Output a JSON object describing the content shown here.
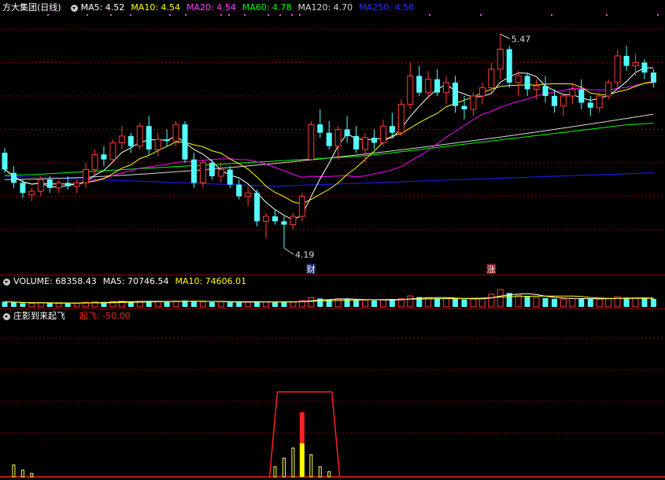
{
  "colors": {
    "background": "#000000",
    "up": "#ff3b3b",
    "down": "#54ffff",
    "ma5": "#ffffff",
    "ma10": "#ffff00",
    "ma20": "#ff00ff",
    "ma60": "#00ff00",
    "ma120": "#d8d8d8",
    "ma250": "#2020ff",
    "grid": "#8a0000"
  },
  "price_panel": {
    "title": "方大集团(日线)",
    "ma_labels": [
      {
        "text": "MA5: 4.52",
        "color": "#ffffff"
      },
      {
        "text": "MA10: 4.54",
        "color": "#ffff00"
      },
      {
        "text": "MA20: 4.54",
        "color": "#ff44ff"
      },
      {
        "text": "MA60: 4.78",
        "color": "#00ff00"
      },
      {
        "text": "MA120: 4.70",
        "color": "#d8d8d8"
      },
      {
        "text": "MA250: 4.56",
        "color": "#3030ff"
      }
    ],
    "high_label": "5.47",
    "low_label": "4.19",
    "markers": [
      {
        "text": "财",
        "index": 34
      },
      {
        "text": "涨",
        "index": 54
      }
    ]
  },
  "volume_panel": {
    "labels": [
      {
        "text": "VOLUME: 68358.43",
        "color": "#ffffff"
      },
      {
        "text": "MA5: 70746.54",
        "color": "#ffffff"
      },
      {
        "text": "MA10: 74606.01",
        "color": "#ffff00"
      }
    ]
  },
  "indicator_panel": {
    "title": "庄影到来起飞",
    "value_label": "起飞: -50.00"
  },
  "chart_data": {
    "type": "candlestick",
    "price_range": [
      4.05,
      5.58
    ],
    "ohlc": [
      [
        4.76,
        4.79,
        4.64,
        4.66
      ],
      [
        4.64,
        4.68,
        4.55,
        4.58
      ],
      [
        4.58,
        4.6,
        4.49,
        4.52
      ],
      [
        4.51,
        4.55,
        4.47,
        4.53
      ],
      [
        4.53,
        4.62,
        4.5,
        4.6
      ],
      [
        4.6,
        4.62,
        4.52,
        4.55
      ],
      [
        4.55,
        4.6,
        4.52,
        4.58
      ],
      [
        4.58,
        4.62,
        4.54,
        4.56
      ],
      [
        4.56,
        4.6,
        4.52,
        4.58
      ],
      [
        4.58,
        4.7,
        4.55,
        4.66
      ],
      [
        4.66,
        4.78,
        4.63,
        4.75
      ],
      [
        4.75,
        4.8,
        4.68,
        4.72
      ],
      [
        4.72,
        4.84,
        4.7,
        4.82
      ],
      [
        4.82,
        4.92,
        4.78,
        4.86
      ],
      [
        4.86,
        4.88,
        4.76,
        4.8
      ],
      [
        4.8,
        4.94,
        4.78,
        4.92
      ],
      [
        4.92,
        4.98,
        4.75,
        4.78
      ],
      [
        4.78,
        4.88,
        4.74,
        4.84
      ],
      [
        4.84,
        4.9,
        4.8,
        4.83
      ],
      [
        4.83,
        4.95,
        4.8,
        4.93
      ],
      [
        4.93,
        4.95,
        4.7,
        4.72
      ],
      [
        4.72,
        4.76,
        4.55,
        4.58
      ],
      [
        4.58,
        4.72,
        4.55,
        4.7
      ],
      [
        4.7,
        4.72,
        4.6,
        4.62
      ],
      [
        4.62,
        4.7,
        4.58,
        4.66
      ],
      [
        4.66,
        4.68,
        4.55,
        4.57
      ],
      [
        4.57,
        4.6,
        4.48,
        4.5
      ],
      [
        4.5,
        4.56,
        4.44,
        4.52
      ],
      [
        4.52,
        4.54,
        4.32,
        4.35
      ],
      [
        4.35,
        4.4,
        4.25,
        4.38
      ],
      [
        4.38,
        4.42,
        4.33,
        4.35
      ],
      [
        4.35,
        4.38,
        4.19,
        4.33
      ],
      [
        4.33,
        4.4,
        4.3,
        4.38
      ],
      [
        4.38,
        4.52,
        4.35,
        4.5
      ],
      [
        4.72,
        4.95,
        4.72,
        4.93
      ],
      [
        4.93,
        5.02,
        4.85,
        4.88
      ],
      [
        4.88,
        4.95,
        4.78,
        4.8
      ],
      [
        4.8,
        4.92,
        4.72,
        4.9
      ],
      [
        4.9,
        4.98,
        4.82,
        4.86
      ],
      [
        4.86,
        4.92,
        4.76,
        4.78
      ],
      [
        4.78,
        4.88,
        4.7,
        4.85
      ],
      [
        4.85,
        4.9,
        4.78,
        4.82
      ],
      [
        4.82,
        4.96,
        4.8,
        4.92
      ],
      [
        4.92,
        5,
        4.85,
        4.88
      ],
      [
        4.88,
        5.08,
        4.86,
        5.05
      ],
      [
        5.05,
        5.3,
        5.02,
        5.22
      ],
      [
        5.22,
        5.28,
        5.1,
        5.12
      ],
      [
        5.12,
        5.25,
        5.08,
        5.2
      ],
      [
        5.2,
        5.26,
        5.1,
        5.12
      ],
      [
        5.12,
        5.22,
        5.05,
        5.18
      ],
      [
        5.18,
        5.22,
        5,
        5.04
      ],
      [
        5.04,
        5.1,
        4.96,
        5.02
      ],
      [
        5.02,
        5.12,
        4.98,
        5.1
      ],
      [
        5.1,
        5.18,
        5.05,
        5.15
      ],
      [
        5.15,
        5.3,
        5.12,
        5.26
      ],
      [
        5.26,
        5.47,
        5.2,
        5.38
      ],
      [
        5.38,
        5.4,
        5.15,
        5.18
      ],
      [
        5.18,
        5.25,
        5.1,
        5.22
      ],
      [
        5.22,
        5.24,
        5.1,
        5.14
      ],
      [
        5.14,
        5.2,
        5.08,
        5.16
      ],
      [
        5.16,
        5.22,
        5.06,
        5.1
      ],
      [
        5.1,
        5.14,
        5,
        5.04
      ],
      [
        5.04,
        5.12,
        4.98,
        5.1
      ],
      [
        5.1,
        5.18,
        5.05,
        5.14
      ],
      [
        5.14,
        5.2,
        5.02,
        5.06
      ],
      [
        5.06,
        5.1,
        4.98,
        5.03
      ],
      [
        5.03,
        5.12,
        5,
        5.1
      ],
      [
        5.1,
        5.2,
        5.08,
        5.18
      ],
      [
        5.18,
        5.38,
        5.15,
        5.34
      ],
      [
        5.34,
        5.4,
        5.25,
        5.28
      ],
      [
        5.28,
        5.35,
        5.22,
        5.3
      ],
      [
        5.3,
        5.32,
        5.2,
        5.24
      ],
      [
        5.24,
        5.26,
        5.15,
        5.18
      ]
    ],
    "volume": [
      45,
      38,
      32,
      30,
      36,
      33,
      31,
      30,
      32,
      40,
      44,
      42,
      46,
      50,
      44,
      48,
      52,
      46,
      44,
      50,
      55,
      48,
      44,
      42,
      45,
      40,
      38,
      42,
      48,
      44,
      40,
      46,
      42,
      55,
      80,
      72,
      64,
      70,
      66,
      60,
      58,
      56,
      62,
      60,
      70,
      95,
      85,
      80,
      75,
      72,
      70,
      65,
      68,
      75,
      110,
      150,
      120,
      100,
      88,
      80,
      76,
      70,
      68,
      72,
      74,
      70,
      68,
      72,
      88,
      80,
      76,
      72,
      70
    ],
    "indicator": {
      "box_range": [
        30,
        37
      ],
      "peak_index": 33,
      "bars": [
        {
          "index": 1,
          "value": 0.14,
          "color": "#ffff55"
        },
        {
          "index": 2,
          "value": 0.08,
          "color": "#ffff55"
        },
        {
          "index": 3,
          "value": 0.04,
          "color": "#ffff55"
        },
        {
          "index": 30,
          "value": 0.12,
          "color": "#ffff55"
        },
        {
          "index": 31,
          "value": 0.22,
          "color": "#ffff55"
        },
        {
          "index": 32,
          "value": 0.34,
          "color": "#ffff55"
        },
        {
          "index": 33,
          "value": 0.76,
          "color": "#ff2020"
        },
        {
          "index": 34,
          "value": 0.26,
          "color": "#ffff55"
        },
        {
          "index": 35,
          "value": 0.12,
          "color": "#ffff55"
        },
        {
          "index": 36,
          "value": 0.06,
          "color": "#ffff55"
        }
      ]
    }
  }
}
